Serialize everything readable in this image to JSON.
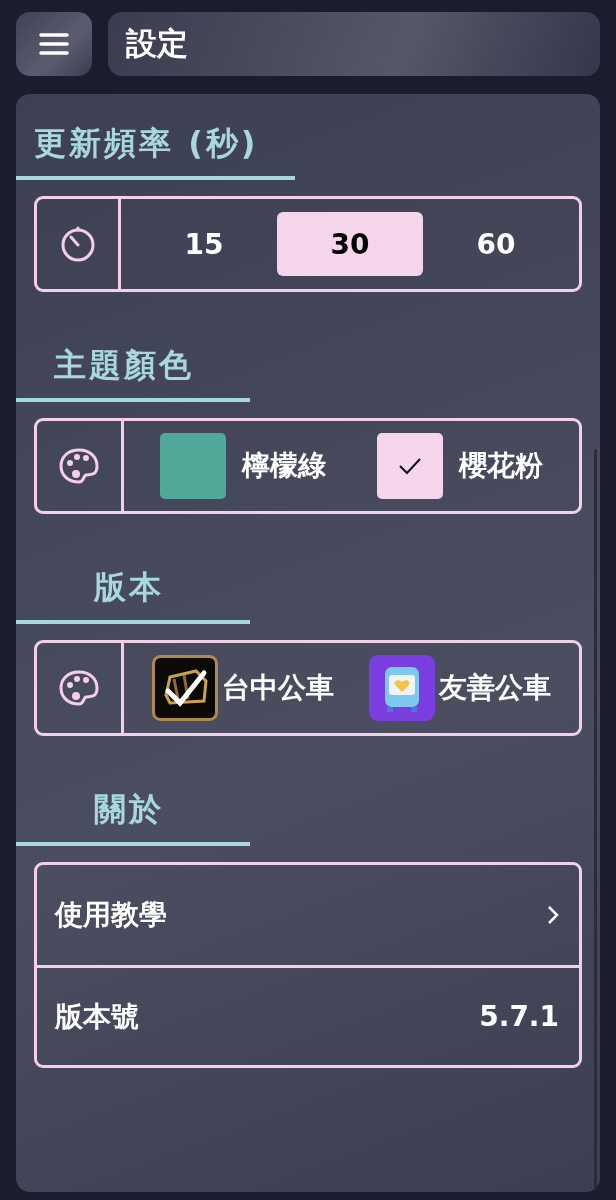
{
  "header": {
    "title": "設定"
  },
  "sections": [
    {
      "kind": "segmented",
      "heading": "更新頻率 (秒)",
      "options": [
        {
          "label": "15",
          "selected": false
        },
        {
          "label": "30",
          "selected": true
        },
        {
          "label": "60",
          "selected": false
        }
      ]
    },
    {
      "kind": "theme",
      "heading": "主題顏色",
      "options": [
        {
          "label": "檸檬綠",
          "color": "#4fa898",
          "checked": false
        },
        {
          "label": "櫻花粉",
          "color": "#f5d5eb",
          "checked": true
        }
      ]
    },
    {
      "kind": "apps",
      "heading": "版本",
      "options": [
        {
          "label": "台中公車",
          "selected": true
        },
        {
          "label": "友善公車",
          "selected": false
        }
      ]
    },
    {
      "kind": "list",
      "heading": "關於",
      "rows": [
        {
          "label": "使用教學",
          "kind": "link"
        },
        {
          "label": "版本號",
          "kind": "value",
          "value": "5.7.1"
        }
      ]
    }
  ]
}
